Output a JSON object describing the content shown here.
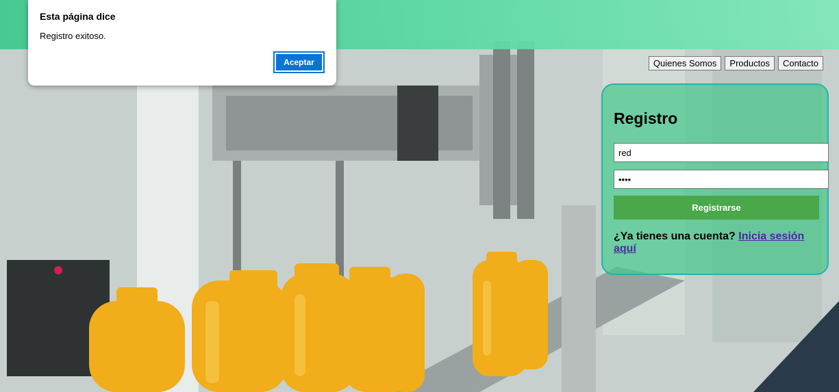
{
  "dialog": {
    "title": "Esta página dice",
    "message": "Registro exitoso.",
    "ok_label": "Aceptar"
  },
  "nav": {
    "items": [
      {
        "label": "Quienes Somos"
      },
      {
        "label": "Productos"
      },
      {
        "label": "Contacto"
      }
    ]
  },
  "register": {
    "title": "Registro",
    "username_value": "red",
    "password_value": "••••",
    "submit_label": "Registrarse",
    "login_prompt": "¿Ya tienes una cuenta?",
    "login_link": "Inicia sesión aquí"
  },
  "colors": {
    "header_band": "#4fd39a",
    "panel_border": "#1fb5b0",
    "submit_bg": "#4aa84a",
    "dialog_button": "#0a74d6",
    "link": "#4a2aa0"
  }
}
